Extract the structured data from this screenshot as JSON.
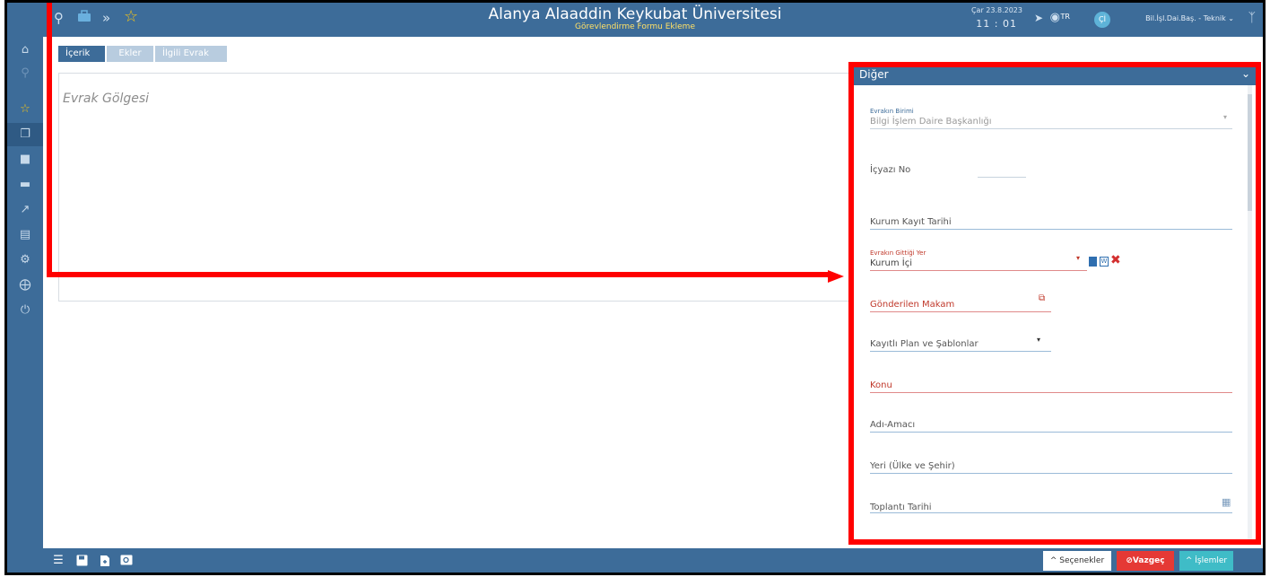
{
  "header": {
    "title": "Alanya Alaaddin Keykubat Üniversitesi",
    "subtitle": "Görevlendirme Formu Ekleme",
    "date": "Çar 23.8.2023",
    "time": "11 : 01",
    "lang": "TR",
    "avatar": "Çİ",
    "user": "Bil.İşl.Dai.Baş. - Teknik"
  },
  "tabs": [
    {
      "label": "İçerik"
    },
    {
      "label": "Ekler"
    },
    {
      "label": "İlgili Evrak"
    }
  ],
  "main": {
    "placeholder": "Evrak Gölgesi"
  },
  "panel": {
    "title": "Diğer",
    "fields": {
      "evrakin_birimi_label": "Evrakın Birimi",
      "evrakin_birimi_value": "Bilgi İşlem Daire Başkanlığı",
      "icyazi_no": "İçyazı No",
      "kurum_kayit_tarihi": "Kurum Kayıt Tarihi",
      "evrakin_gittigi_yer_label": "Evrakın Gittiği Yer",
      "evrakin_gittigi_yer_value": "Kurum İçi",
      "gonderilen_makam": "Gönderilen Makam",
      "kayitli_plan": "Kayıtlı Plan ve Şablonlar",
      "konu": "Konu",
      "adi_amaci": "Adı-Amacı",
      "yeri": "Yeri (Ülke ve Şehir)",
      "toplanti_tarihi": "Toplantı Tarihi"
    }
  },
  "footer": {
    "secenekler": "^ Seçenekler",
    "vazgec": "⊘Vazgeç",
    "islemler": "^ İşlemler"
  },
  "colors": {
    "primary": "#3d6c99",
    "highlight": "#ff0000",
    "vazgec": "#e53935",
    "islemler": "#3fbcc7"
  }
}
